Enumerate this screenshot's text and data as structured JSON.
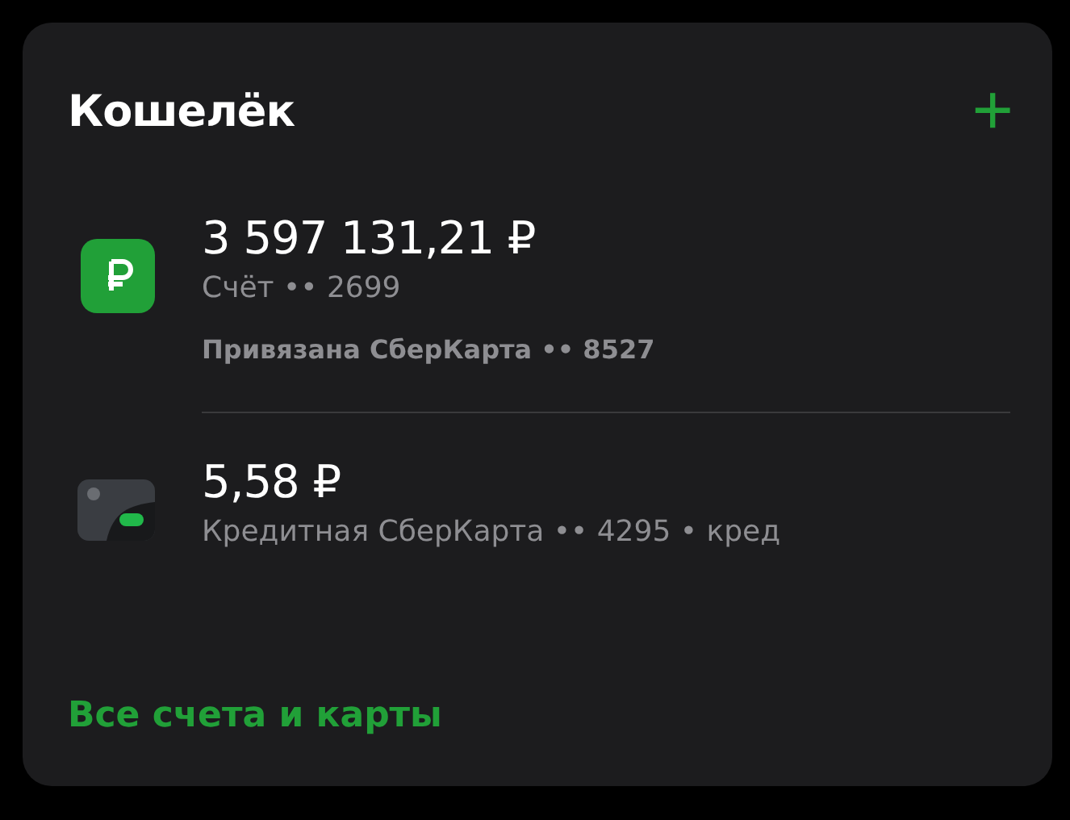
{
  "wallet": {
    "title": "Кошелёк",
    "add_button": "+",
    "items": [
      {
        "kind": "account",
        "amount": "3 597 131,21 ₽",
        "subtitle": "Счёт •• 2699",
        "note": "Привязана СберКарта •• 8527"
      },
      {
        "kind": "card",
        "amount": "5,58 ₽",
        "subtitle": "Кредитная СберКарта •• 4295 • кред"
      }
    ],
    "link": "Все счета и карты"
  }
}
